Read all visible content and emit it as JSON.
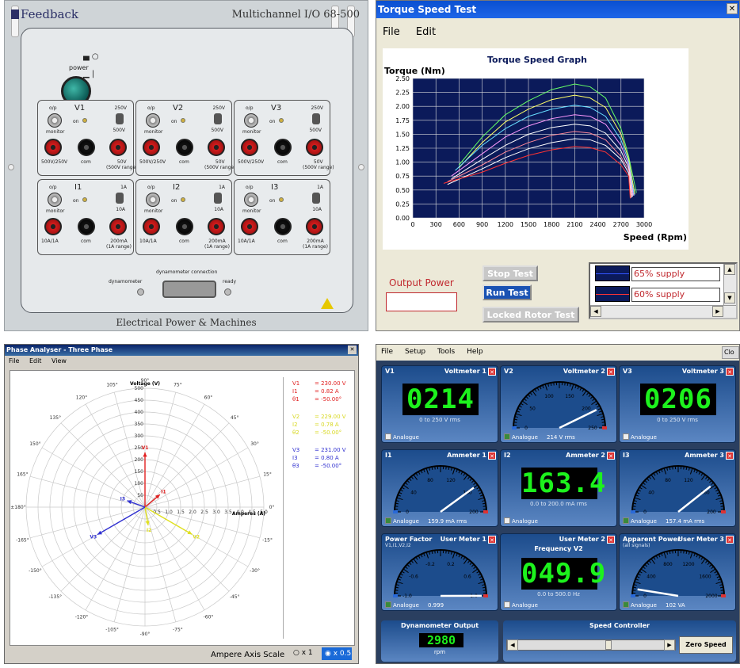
{
  "hardware": {
    "brand": "Feedback",
    "model": "Multichannel I/O  68-500",
    "footer": "Electrical Power & Machines",
    "power_label": "power",
    "voltage_modules": [
      {
        "name": "V1",
        "top_left": "o/p",
        "top_right": "250V",
        "mon": "monitor",
        "on": "on",
        "sw_low": "500V",
        "j1": "500V/250V",
        "j2": "com",
        "j3": "50V\n(500V range)"
      },
      {
        "name": "V2",
        "top_left": "o/p",
        "top_right": "250V",
        "mon": "monitor",
        "on": "on",
        "sw_low": "500V",
        "j1": "500V/250V",
        "j2": "com",
        "j3": "50V\n(500V range)"
      },
      {
        "name": "V3",
        "top_left": "o/p",
        "top_right": "250V",
        "mon": "monitor",
        "on": "on",
        "sw_low": "500V",
        "j1": "500V/250V",
        "j2": "com",
        "j3": "50V\n(500V range)"
      }
    ],
    "current_modules": [
      {
        "name": "I1",
        "top_left": "o/p",
        "top_right": "1A",
        "mon": "monitor",
        "on": "on",
        "sw_low": "10A",
        "j1": "10A/1A",
        "j2": "com",
        "j3": "200mA\n(1A range)"
      },
      {
        "name": "I2",
        "top_left": "o/p",
        "top_right": "1A",
        "mon": "monitor",
        "on": "on",
        "sw_low": "10A",
        "j1": "10A/1A",
        "j2": "com",
        "j3": "200mA\n(1A range)"
      },
      {
        "name": "I3",
        "top_left": "o/p",
        "top_right": "1A",
        "mon": "monitor",
        "on": "on",
        "sw_low": "10A",
        "j1": "10A/1A",
        "j2": "com",
        "j3": "200mA\n(1A range)"
      }
    ],
    "dyn_connection": "dynamometer connection",
    "dyn_label": "dynamometer",
    "ready_label": "ready"
  },
  "torque": {
    "window_title": "Torque Speed Test",
    "menu": [
      "File",
      "Edit"
    ],
    "stop_label": "Stop Test",
    "run_label": "Run Test",
    "locked_label": "Locked Rotor Test",
    "output_power_label": "Output Power",
    "legend": [
      {
        "label": "65% supply",
        "color": "#0b1a5a"
      },
      {
        "label": "60% supply",
        "color": "#c0282e"
      }
    ],
    "chart_data": {
      "type": "line",
      "title": "Torque Speed Graph",
      "ylabel": "Torque (Nm)",
      "xlabel": "Speed (Rpm)",
      "xlim": [
        0,
        3000
      ],
      "ylim": [
        0,
        2.5
      ],
      "xticks": [
        0,
        300,
        600,
        900,
        1200,
        1500,
        1800,
        2100,
        2400,
        2700,
        3000
      ],
      "yticks": [
        "0.00",
        "0.25",
        "0.50",
        "0.75",
        "1.00",
        "1.25",
        "1.50",
        "1.75",
        "2.00",
        "2.25",
        "2.50"
      ],
      "grid": true,
      "background": "#0b1a5a",
      "series": [
        {
          "color": "#66ff66",
          "x": [
            600,
            900,
            1200,
            1500,
            1800,
            2100,
            2300,
            2500,
            2700,
            2800,
            2900
          ],
          "y": [
            0.95,
            1.45,
            1.85,
            2.1,
            2.3,
            2.4,
            2.35,
            2.15,
            1.6,
            1.1,
            0.45
          ]
        },
        {
          "color": "#ffff66",
          "x": [
            600,
            900,
            1200,
            1500,
            1800,
            2100,
            2300,
            2500,
            2700,
            2800,
            2880
          ],
          "y": [
            0.9,
            1.35,
            1.72,
            1.95,
            2.12,
            2.2,
            2.15,
            1.98,
            1.5,
            1.05,
            0.42
          ]
        },
        {
          "color": "#66ddff",
          "x": [
            550,
            900,
            1200,
            1500,
            1800,
            2100,
            2300,
            2500,
            2700,
            2800,
            2870
          ],
          "y": [
            0.85,
            1.3,
            1.6,
            1.82,
            1.95,
            2.02,
            1.98,
            1.82,
            1.4,
            1.0,
            0.4
          ]
        },
        {
          "color": "#ff99ff",
          "x": [
            500,
            900,
            1200,
            1500,
            1800,
            2100,
            2300,
            2500,
            2700,
            2800,
            2860
          ],
          "y": [
            0.75,
            1.15,
            1.45,
            1.65,
            1.78,
            1.85,
            1.82,
            1.68,
            1.3,
            0.95,
            0.4
          ]
        },
        {
          "color": "#ffffff",
          "x": [
            500,
            900,
            1200,
            1500,
            1800,
            2100,
            2300,
            2500,
            2700,
            2800,
            2850
          ],
          "y": [
            0.7,
            1.05,
            1.3,
            1.5,
            1.62,
            1.68,
            1.65,
            1.52,
            1.2,
            0.9,
            0.38
          ]
        },
        {
          "color": "#ff8899",
          "x": [
            450,
            900,
            1200,
            1500,
            1800,
            2100,
            2300,
            2500,
            2700,
            2800,
            2840
          ],
          "y": [
            0.65,
            0.95,
            1.18,
            1.35,
            1.48,
            1.55,
            1.52,
            1.4,
            1.1,
            0.85,
            0.37
          ]
        },
        {
          "color": "#ffffff",
          "x": [
            450,
            900,
            1200,
            1500,
            1800,
            2100,
            2300,
            2500,
            2700,
            2800,
            2830
          ],
          "y": [
            0.6,
            0.88,
            1.08,
            1.24,
            1.35,
            1.42,
            1.4,
            1.3,
            1.05,
            0.8,
            0.36
          ]
        },
        {
          "color": "#ff3333",
          "x": [
            400,
            900,
            1200,
            1500,
            1800,
            2100,
            2300,
            2500,
            2700,
            2800,
            2820
          ],
          "y": [
            0.62,
            0.82,
            0.98,
            1.12,
            1.22,
            1.28,
            1.26,
            1.18,
            0.95,
            0.75,
            0.35
          ]
        }
      ]
    }
  },
  "phase": {
    "window_title": "Phase Analyser - Three Phase",
    "menu": [
      "File",
      "Edit",
      "View"
    ],
    "axis_scale_label": "Ampere Axis Scale",
    "opt1": "x 1",
    "opt2": "x 0.5",
    "chart_data": {
      "type": "scatter",
      "voltage_label": "Voltage (V)",
      "amperes_label": "Amperes (A)",
      "voltage_ticks": [
        50,
        100,
        150,
        200,
        250,
        300,
        350,
        400,
        450,
        500
      ],
      "amp_ticks": [
        "0.5",
        "1.0",
        "1.5",
        "2.0",
        "2.5",
        "3.0",
        "3.5",
        "4.0",
        "4.5",
        "5.0"
      ],
      "angle_labels": [
        "0°",
        "15°",
        "30°",
        "45°",
        "60°",
        "75°",
        "90°",
        "105°",
        "120°",
        "135°",
        "150°",
        "165°",
        "±180°",
        "-165°",
        "-150°",
        "-135°",
        "-120°",
        "-105°",
        "-90°",
        "-75°",
        "-60°",
        "-45°",
        "-30°",
        "-15°"
      ],
      "phasors": [
        {
          "name": "V1",
          "mag_v": 230,
          "angle": 90,
          "color": "#e02020"
        },
        {
          "name": "I1",
          "mag_a": 0.82,
          "angle": 40,
          "color": "#e02020"
        },
        {
          "name": "V2",
          "mag_v": 229,
          "angle": -30,
          "color": "#e0e020"
        },
        {
          "name": "I2",
          "mag_a": 0.78,
          "angle": -80,
          "color": "#e0e020"
        },
        {
          "name": "V3",
          "mag_v": 231,
          "angle": -150,
          "color": "#3030d0"
        },
        {
          "name": "I3",
          "mag_a": 0.8,
          "angle": 160,
          "color": "#3030d0"
        }
      ],
      "readouts": [
        {
          "label": "V1",
          "value": "= 230.00  V",
          "color": "#e02020"
        },
        {
          "label": "I1",
          "value": "= 0.82  A",
          "color": "#e02020"
        },
        {
          "label": "θ1",
          "value": "= -50.00°",
          "color": "#e02020"
        },
        {
          "label": "V2",
          "value": "= 229.00  V",
          "color": "#d8d820"
        },
        {
          "label": "I2",
          "value": "= 0.78  A",
          "color": "#d8d820"
        },
        {
          "label": "θ2",
          "value": "= -50.00°",
          "color": "#d8d820"
        },
        {
          "label": "V3",
          "value": "= 231.00  V",
          "color": "#3030d0"
        },
        {
          "label": "I3",
          "value": "= 0.80  A",
          "color": "#3030d0"
        },
        {
          "label": "θ3",
          "value": "= -50.00°",
          "color": "#3030d0"
        }
      ],
      "grid": true
    }
  },
  "meters": {
    "menu": [
      "File",
      "Setup",
      "Tools",
      "Help"
    ],
    "close": "Clo",
    "analogue": "Analogue",
    "items": [
      {
        "id": "V1",
        "name": "Voltmeter 1",
        "kind": "digital",
        "display": "0214",
        "range": "0 to 250 V rms",
        "analogue_on": false
      },
      {
        "id": "V2",
        "name": "Voltmeter 2",
        "kind": "analog",
        "reading": "214 V rms",
        "analogue_on": true,
        "max": 250,
        "value": 214,
        "ticks": [
          "0",
          "25",
          "50",
          "75",
          "100",
          "125",
          "150",
          "175",
          "200",
          "225",
          "250"
        ]
      },
      {
        "id": "V3",
        "name": "Voltmeter 3",
        "kind": "digital",
        "display": "0206",
        "range": "0 to 250 V rms",
        "analogue_on": false
      },
      {
        "id": "I1",
        "name": "Ammeter 1",
        "kind": "analog",
        "reading": "159.9 mA rms",
        "analogue_on": true,
        "max": 200,
        "value": 159.9,
        "ticks": [
          "0",
          "20",
          "40",
          "60",
          "80",
          "100",
          "120",
          "140",
          "160",
          "180",
          "200"
        ]
      },
      {
        "id": "I2",
        "name": "Ammeter 2",
        "kind": "digital",
        "display": "163.4",
        "range": "0.0 to 200.0 mA rms",
        "analogue_on": false
      },
      {
        "id": "I3",
        "name": "Ammeter 3",
        "kind": "analog",
        "reading": "157.4 mA rms",
        "analogue_on": true,
        "max": 200,
        "value": 157.4,
        "ticks": [
          "0",
          "20",
          "40",
          "60",
          "80",
          "100",
          "120",
          "140",
          "160",
          "180",
          "200"
        ]
      },
      {
        "id": "Power Factor",
        "sub": "V1,I1,V2,I2",
        "name": "User Meter 1",
        "kind": "analog",
        "reading": "0.999",
        "analogue_on": true,
        "min": -1,
        "max": 1,
        "value": 0.999,
        "center": true,
        "ticks": [
          "-1.0",
          "-0.8",
          "-0.6",
          "-0.4",
          "-0.2",
          "0.0",
          "0.2",
          "0.4",
          "0.6",
          "0.8",
          "1.0"
        ]
      },
      {
        "id": "",
        "name": "User Meter 2",
        "kind": "digital",
        "label": "Frequency V2",
        "display": "049.9",
        "range": "0.0 to 500.0 Hz",
        "analogue_on": false
      },
      {
        "id": "Apparent Power",
        "sub": "(all signals)",
        "name": "User Meter 3",
        "kind": "analog",
        "reading": "102 VA",
        "analogue_on": true,
        "max": 2000,
        "value": 102,
        "ticks": [
          "0",
          "200",
          "400",
          "600",
          "800",
          "1000",
          "1200",
          "1400",
          "1600",
          "1800",
          "2000"
        ]
      }
    ],
    "dyn_title": "Dynamometer Output",
    "dyn_value": "2980",
    "dyn_unit": "rpm",
    "speed_title": "Speed Controller",
    "speed_position": 0.62,
    "zero_label": "Zero Speed"
  }
}
